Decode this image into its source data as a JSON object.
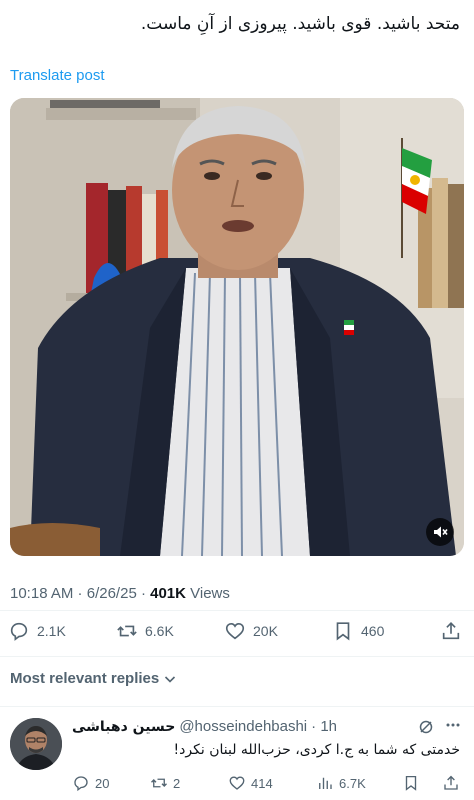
{
  "post": {
    "text": "متحد باشید. قوی باشید. پیروزی از آنِ ماست.",
    "translate_label": "Translate post"
  },
  "media": {
    "mute_icon": "volume-mute-icon"
  },
  "meta": {
    "time": "10:18 AM",
    "separator": " · ",
    "date": "6/26/25",
    "views_count": "401K",
    "views_label": " Views"
  },
  "actions": {
    "replies": "2.1K",
    "reposts": "6.6K",
    "likes": "20K",
    "bookmarks": "460"
  },
  "replies_sort": {
    "label": "Most relevant replies"
  },
  "reply": {
    "name": "حسین دهباشی",
    "handle": "@hosseindehbashi",
    "time": "· 1h",
    "text": "خدمتی که شما به ج.ا کردی، حزب‌الله لبنان نکرد!",
    "replies": "20",
    "reposts": "2",
    "likes": "414",
    "views": "6.7K"
  },
  "colors": {
    "accent": "#1d9bf0",
    "text": "#0f1419",
    "muted": "#536471"
  }
}
